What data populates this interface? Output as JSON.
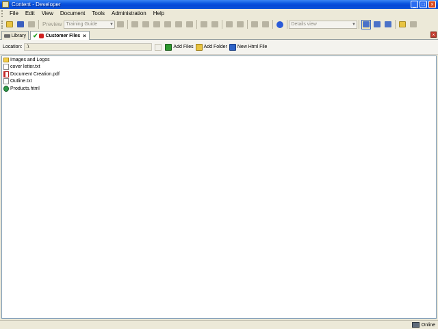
{
  "window": {
    "title": "Content - Developer",
    "buttons": [
      "_",
      "□",
      "×"
    ]
  },
  "menu": [
    "File",
    "Edit",
    "View",
    "Document",
    "Tools",
    "Administration",
    "Help"
  ],
  "toolbar": {
    "preview_label": "Preview",
    "guide_select": "Training Guide",
    "view_select": "Details view"
  },
  "tabs": {
    "library": "Library",
    "customer_files": "Customer Files",
    "close_glyph": "×"
  },
  "location": {
    "label": "Location:",
    "value": ".\\",
    "actions": {
      "add_files": "Add Files",
      "add_folder": "Add Folder",
      "new_html": "New Html File"
    }
  },
  "files": [
    {
      "name": "Images and Logos",
      "icon": "folder-icon"
    },
    {
      "name": "cover letter.txt",
      "icon": "text-file-icon"
    },
    {
      "name": "Document Creation.pdf",
      "icon": "pdf-file-icon"
    },
    {
      "name": "Outline.txt",
      "icon": "text-file-icon"
    },
    {
      "name": "Products.html",
      "icon": "html-file-icon"
    }
  ],
  "status": {
    "text": "Online"
  }
}
